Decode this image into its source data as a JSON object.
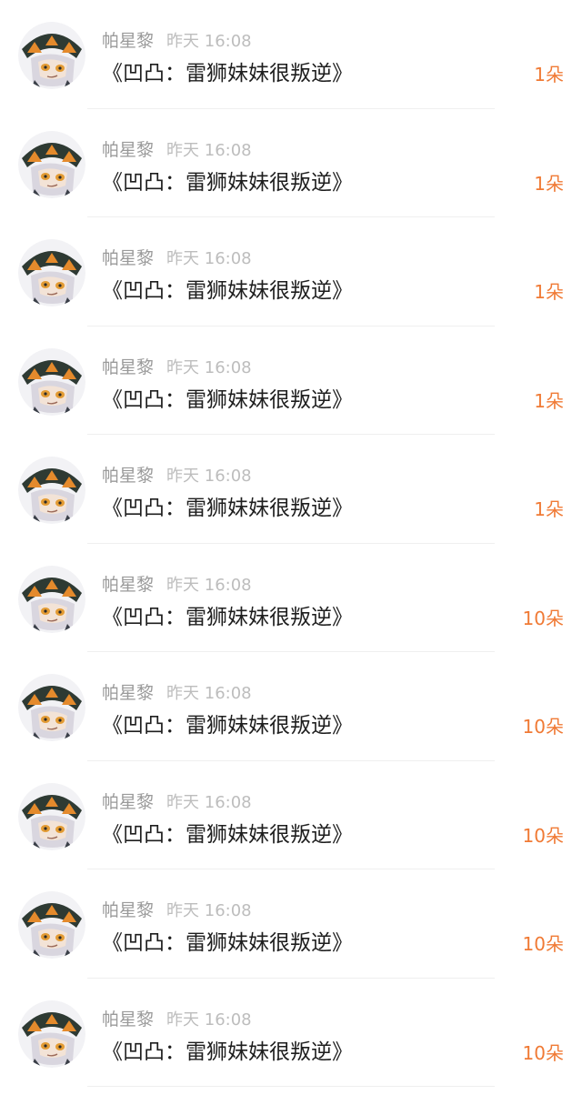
{
  "colors": {
    "accent": "#f07a35",
    "name": "#9a9a9a",
    "time": "#bdbdbd",
    "title": "#1e1e1e",
    "divider": "#efefef"
  },
  "avatar_icon": "avatar-icon",
  "items": [
    {
      "name": "帕星黎",
      "time": "昨天 16:08",
      "title": "《凹凸：雷狮妹妹很叛逆》",
      "amount": "1朵"
    },
    {
      "name": "帕星黎",
      "time": "昨天 16:08",
      "title": "《凹凸：雷狮妹妹很叛逆》",
      "amount": "1朵"
    },
    {
      "name": "帕星黎",
      "time": "昨天 16:08",
      "title": "《凹凸：雷狮妹妹很叛逆》",
      "amount": "1朵"
    },
    {
      "name": "帕星黎",
      "time": "昨天 16:08",
      "title": "《凹凸：雷狮妹妹很叛逆》",
      "amount": "1朵"
    },
    {
      "name": "帕星黎",
      "time": "昨天 16:08",
      "title": "《凹凸：雷狮妹妹很叛逆》",
      "amount": "1朵"
    },
    {
      "name": "帕星黎",
      "time": "昨天 16:08",
      "title": "《凹凸：雷狮妹妹很叛逆》",
      "amount": "10朵"
    },
    {
      "name": "帕星黎",
      "time": "昨天 16:08",
      "title": "《凹凸：雷狮妹妹很叛逆》",
      "amount": "10朵"
    },
    {
      "name": "帕星黎",
      "time": "昨天 16:08",
      "title": "《凹凸：雷狮妹妹很叛逆》",
      "amount": "10朵"
    },
    {
      "name": "帕星黎",
      "time": "昨天 16:08",
      "title": "《凹凸：雷狮妹妹很叛逆》",
      "amount": "10朵"
    },
    {
      "name": "帕星黎",
      "time": "昨天 16:08",
      "title": "《凹凸：雷狮妹妹很叛逆》",
      "amount": "10朵"
    }
  ]
}
